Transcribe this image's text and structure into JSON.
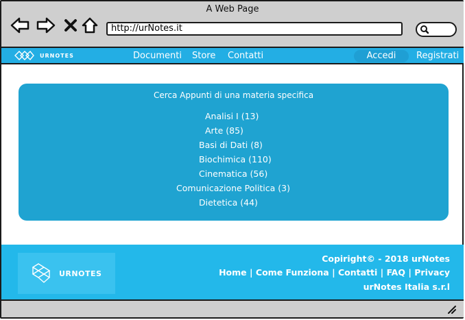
{
  "window": {
    "title": "A Web Page"
  },
  "browser": {
    "url": "http://urNotes.it"
  },
  "nav": {
    "brand": "URNOTES",
    "links": [
      "Documenti",
      "Store",
      "Contatti"
    ],
    "login": "Accedi",
    "register": "Registrati"
  },
  "panel": {
    "title": "Cerca Appunti di una materia specifica",
    "subjects": [
      "Analisi I (13)",
      "Arte (85)",
      "Basi di Dati (8)",
      "Biochimica (110)",
      "Cinematica (56)",
      "Comunicazione Politica (3)",
      "Dietetica (44)"
    ]
  },
  "footer": {
    "brand": "URNOTES",
    "copyright": "Copiright© - 2018 urNotes",
    "links": "Home | Come Funziona | Contatti | FAQ | Privacy",
    "company": "urNotes Italia s.r.l"
  },
  "colors": {
    "accent": "#23aee4",
    "panel": "#1fa3d1",
    "footer": "#23b8ea",
    "chrome": "#cfcfcf"
  }
}
